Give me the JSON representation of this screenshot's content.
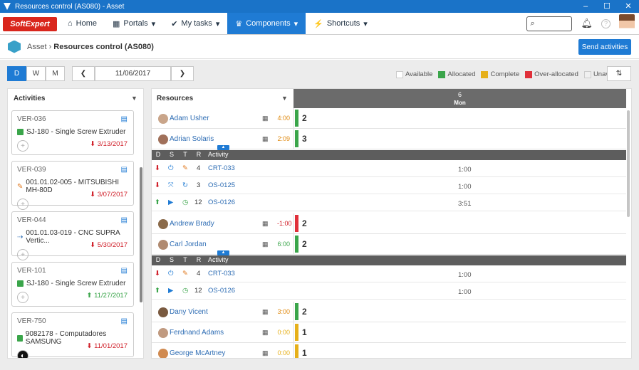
{
  "window": {
    "title": "Resources control (AS080) - Asset",
    "minimize": "–",
    "maximize": "☐",
    "close": "✕"
  },
  "nav": {
    "logo": "SoftExpert",
    "home": "Home",
    "portals": "Portals",
    "tasks": "My tasks",
    "components": "Components",
    "shortcuts": "Shortcuts"
  },
  "breadcrumb": {
    "root": "Asset",
    "page": "Resources control (AS080)"
  },
  "send_button": "Send activities",
  "views": [
    "D",
    "W",
    "M"
  ],
  "date": "11/06/2017",
  "legend": [
    {
      "label": "Available",
      "color": "#ffffff"
    },
    {
      "label": "Allocated",
      "color": "#3aa54a"
    },
    {
      "label": "Complete",
      "color": "#e6b01a"
    },
    {
      "label": "Over-allocated",
      "color": "#e0303a"
    },
    {
      "label": "Unavailable",
      "color": "#f0f0f0"
    }
  ],
  "activities": {
    "title": "Activities",
    "cards": [
      {
        "code": "VER-036",
        "item": "SJ-180 - Single Screw Extruder",
        "date": "3/13/2017",
        "status": "late"
      },
      {
        "code": "VER-039",
        "item": "001.01.02-005 - MITSUBISHI MH-80D",
        "date": "3/07/2017",
        "status": "late"
      },
      {
        "code": "VER-044",
        "item": "001.01.03-019 - CNC SUPRA Vertic...",
        "date": "5/30/2017",
        "status": "late"
      },
      {
        "code": "VER-101",
        "item": "SJ-180 - Single Screw Extruder",
        "date": "11/27/2017",
        "status": "ok"
      },
      {
        "code": "VER-750",
        "item": "9082178 - Computadores SAMSUNG",
        "date": "11/01/2017",
        "status": "late"
      }
    ]
  },
  "resources": {
    "title": "Resources",
    "day": "6",
    "dow": "Mon",
    "sub_headers": [
      "D",
      "S",
      "T",
      "R",
      "Activity"
    ],
    "rows": [
      {
        "name": "Adam Usher",
        "hours": "4:00",
        "count": "2",
        "status": "allocated"
      },
      {
        "name": "Adrian Solaris",
        "hours": "2:09",
        "count": "3",
        "status": "allocated"
      },
      {
        "name": "Andrew Brady",
        "hours": "-1:00",
        "count": "2",
        "status": "over"
      },
      {
        "name": "Carl Jordan",
        "hours": "6:00",
        "count": "2",
        "status": "allocated"
      },
      {
        "name": "Dany Vicent",
        "hours": "3:00",
        "count": "2",
        "status": "allocated"
      },
      {
        "name": "Ferdnand Adams",
        "hours": "0:00",
        "count": "1",
        "status": "complete"
      },
      {
        "name": "George McArtney",
        "hours": "0:00",
        "count": "1",
        "status": "complete"
      }
    ],
    "adrian_acts": [
      {
        "r": "4",
        "code": "CRT-033",
        "time": "1:00"
      },
      {
        "r": "3",
        "code": "OS-0125",
        "time": "1:00"
      },
      {
        "r": "12",
        "code": "OS-0126",
        "time": "3:51"
      }
    ],
    "carl_acts": [
      {
        "r": "4",
        "code": "CRT-033",
        "time": "1:00"
      },
      {
        "r": "12",
        "code": "OS-0126",
        "time": "1:00"
      }
    ]
  }
}
